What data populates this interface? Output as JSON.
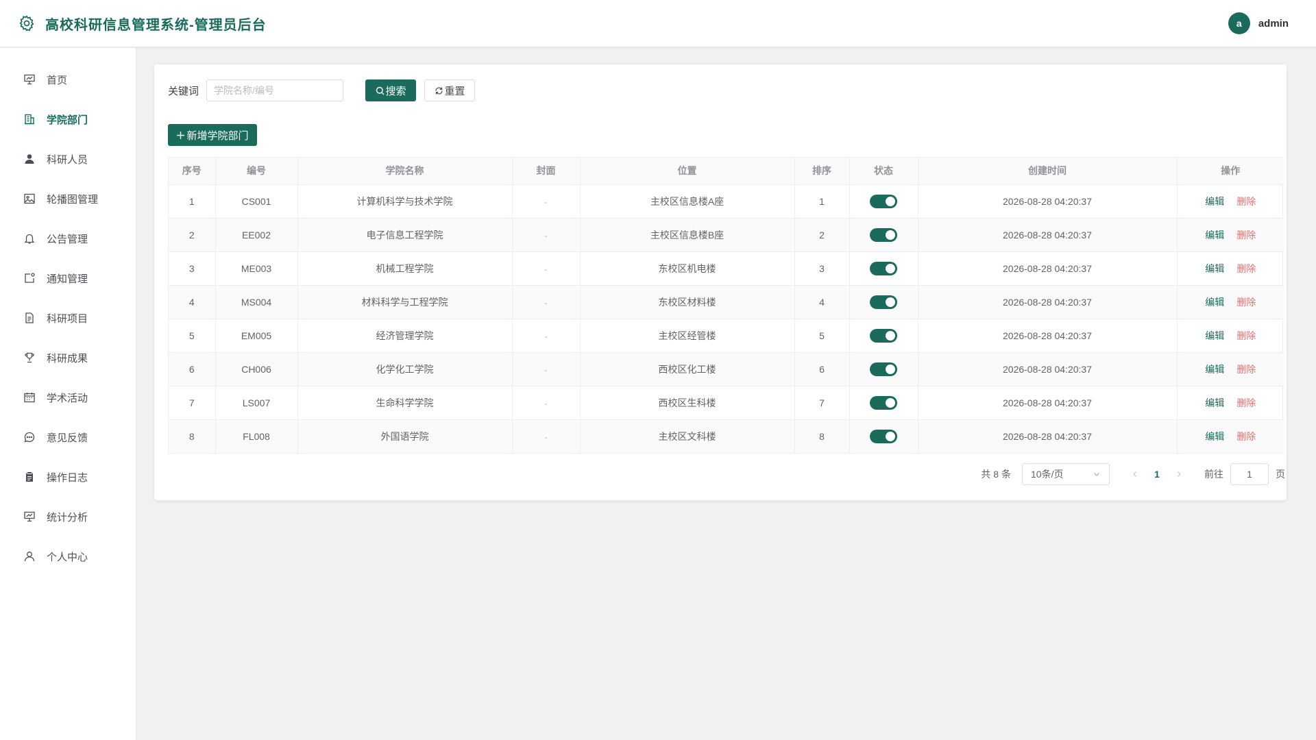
{
  "app": {
    "title": "高校科研信息管理系统-管理员后台",
    "brand_color": "#1a6b5c",
    "danger_color": "#f07070"
  },
  "user": {
    "avatar_letter": "a",
    "name": "admin"
  },
  "sidebar": {
    "items": [
      {
        "label": "首页",
        "icon": "dashboard-icon",
        "active": false
      },
      {
        "label": "学院部门",
        "icon": "building-icon",
        "active": true
      },
      {
        "label": "科研人员",
        "icon": "user-icon",
        "active": false
      },
      {
        "label": "轮播图管理",
        "icon": "picture-icon",
        "active": false
      },
      {
        "label": "公告管理",
        "icon": "bell-icon",
        "active": false
      },
      {
        "label": "通知管理",
        "icon": "message-icon",
        "active": false
      },
      {
        "label": "科研项目",
        "icon": "document-icon",
        "active": false
      },
      {
        "label": "科研成果",
        "icon": "trophy-icon",
        "active": false
      },
      {
        "label": "学术活动",
        "icon": "calendar-icon",
        "active": false
      },
      {
        "label": "意见反馈",
        "icon": "chat-icon",
        "active": false
      },
      {
        "label": "操作日志",
        "icon": "clipboard-icon",
        "active": false
      },
      {
        "label": "统计分析",
        "icon": "chart-icon",
        "active": false
      },
      {
        "label": "个人中心",
        "icon": "person-icon",
        "active": false
      }
    ]
  },
  "search": {
    "label": "关键词",
    "value": "",
    "placeholder": "学院名称/编号",
    "search_label": "搜索",
    "reset_label": "重置"
  },
  "toolbar": {
    "add_label": "新增学院部门"
  },
  "table": {
    "columns": [
      "序号",
      "编号",
      "学院名称",
      "封面",
      "位置",
      "排序",
      "状态",
      "创建时间",
      "操作"
    ],
    "cover_placeholder": "-",
    "edit_label": "编辑",
    "delete_label": "删除",
    "rows": [
      {
        "index": "1",
        "code": "CS001",
        "name": "计算机科学与技术学院",
        "location": "主校区信息楼A座",
        "sort": "1",
        "status": true,
        "created": "2026-08-28 04:20:37"
      },
      {
        "index": "2",
        "code": "EE002",
        "name": "电子信息工程学院",
        "location": "主校区信息楼B座",
        "sort": "2",
        "status": true,
        "created": "2026-08-28 04:20:37"
      },
      {
        "index": "3",
        "code": "ME003",
        "name": "机械工程学院",
        "location": "东校区机电楼",
        "sort": "3",
        "status": true,
        "created": "2026-08-28 04:20:37"
      },
      {
        "index": "4",
        "code": "MS004",
        "name": "材料科学与工程学院",
        "location": "东校区材料楼",
        "sort": "4",
        "status": true,
        "created": "2026-08-28 04:20:37"
      },
      {
        "index": "5",
        "code": "EM005",
        "name": "经济管理学院",
        "location": "主校区经管楼",
        "sort": "5",
        "status": true,
        "created": "2026-08-28 04:20:37"
      },
      {
        "index": "6",
        "code": "CH006",
        "name": "化学化工学院",
        "location": "西校区化工楼",
        "sort": "6",
        "status": true,
        "created": "2026-08-28 04:20:37"
      },
      {
        "index": "7",
        "code": "LS007",
        "name": "生命科学学院",
        "location": "西校区生科楼",
        "sort": "7",
        "status": true,
        "created": "2026-08-28 04:20:37"
      },
      {
        "index": "8",
        "code": "FL008",
        "name": "外国语学院",
        "location": "主校区文科楼",
        "sort": "8",
        "status": true,
        "created": "2026-08-28 04:20:37"
      }
    ]
  },
  "pagination": {
    "total_text": "共 8 条",
    "page_size": "10条/页",
    "current_page": "1",
    "goto_label": "前往",
    "goto_value": "1",
    "page_unit": "页"
  }
}
